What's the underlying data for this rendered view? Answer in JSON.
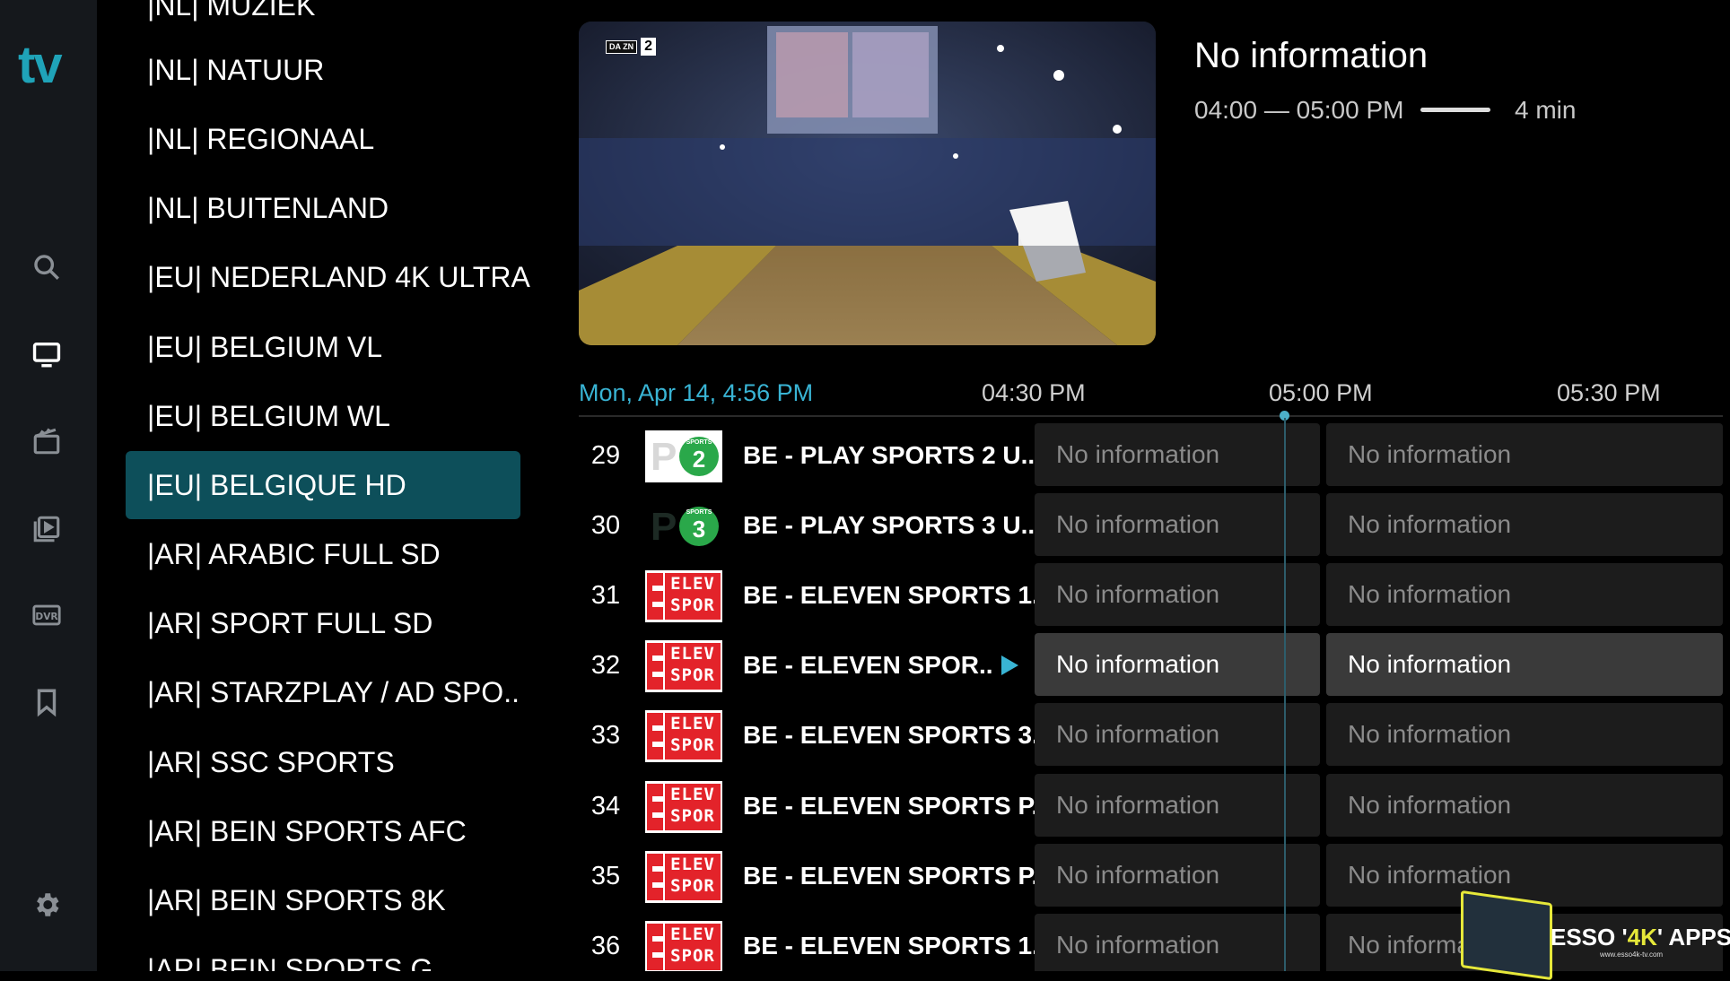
{
  "app": {
    "logo": "tv"
  },
  "rail": {
    "items": [
      {
        "name": "search-icon"
      },
      {
        "name": "live-tv-icon"
      },
      {
        "name": "movies-icon"
      },
      {
        "name": "series-icon"
      },
      {
        "name": "dvr-icon"
      },
      {
        "name": "bookmark-icon"
      },
      {
        "name": "settings-icon"
      }
    ]
  },
  "categories": [
    "|NL| MUZIEK",
    "|NL| NATUUR",
    "|NL| REGIONAAL",
    "|NL| BUITENLAND",
    "|EU| NEDERLAND 4K ULTRA",
    "|EU| BELGIUM VL",
    "|EU| BELGIUM WL",
    "|EU| BELGIQUE HD",
    "|AR| ARABIC FULL SD",
    "|AR| SPORT FULL SD",
    "|AR| STARZPLAY / AD SPO..",
    "|AR| SSC SPORTS",
    "|AR| BEIN SPORTS AFC",
    "|AR| BEIN SPORTS 8K",
    "|AR| BEIN SPORTS G"
  ],
  "selected_category": "|EU| BELGIQUE HD",
  "preview": {
    "badge_text": "DA ZN",
    "badge_number": "2"
  },
  "program": {
    "title": "No information",
    "time": "04:00 — 05:00 PM",
    "duration": "4 min"
  },
  "timeline": {
    "date": "Mon, Apr 14, 4:56 PM",
    "ticks": [
      "04:30 PM",
      "05:00 PM",
      "05:30 PM"
    ]
  },
  "channels": [
    {
      "number": "29",
      "name": "BE - PLAY SPORTS 2 U..",
      "logo": "play-sports-2",
      "programs": [
        "No information",
        "No information"
      ]
    },
    {
      "number": "30",
      "name": "BE - PLAY SPORTS 3 U..",
      "logo": "play-sports-3",
      "programs": [
        "No information",
        "No information"
      ]
    },
    {
      "number": "31",
      "name": "BE - ELEVEN SPORTS 1..",
      "logo": "eleven-sports",
      "programs": [
        "No information",
        "No information"
      ]
    },
    {
      "number": "32",
      "name": "BE - ELEVEN SPOR..",
      "logo": "eleven-sports",
      "programs": [
        "No information",
        "No information"
      ],
      "active": true
    },
    {
      "number": "33",
      "name": "BE - ELEVEN SPORTS 3..",
      "logo": "eleven-sports",
      "programs": [
        "No information",
        "No information"
      ]
    },
    {
      "number": "34",
      "name": "BE - ELEVEN SPORTS P..",
      "logo": "eleven-sports",
      "programs": [
        "No information",
        "No information"
      ]
    },
    {
      "number": "35",
      "name": "BE - ELEVEN SPORTS P..",
      "logo": "eleven-sports",
      "programs": [
        "No information",
        "No information"
      ]
    },
    {
      "number": "36",
      "name": "BE - ELEVEN SPORTS 1..",
      "logo": "eleven-sports",
      "programs": [
        "No information",
        "No informa"
      ]
    }
  ],
  "logos": {
    "play_sports_2": {
      "letter": "P",
      "badge_label": "SPORTS",
      "badge_number": "2"
    },
    "play_sports_3": {
      "letter": "P",
      "badge_label": "SPORTS",
      "badge_number": "3"
    },
    "eleven_sports": {
      "line1": "ELEV",
      "line2": "SPOR"
    }
  },
  "watermark": {
    "title_prefix": "ESSO '",
    "title_accent": "4K",
    "title_suffix": "' APPS",
    "url": "www.esso4k-tv.com"
  },
  "colors": {
    "accent": "#1fa3b8",
    "selected_category_bg": "#0d4f5a",
    "date_text": "#39b4d4",
    "now_indicator": "#4cb0c9"
  }
}
